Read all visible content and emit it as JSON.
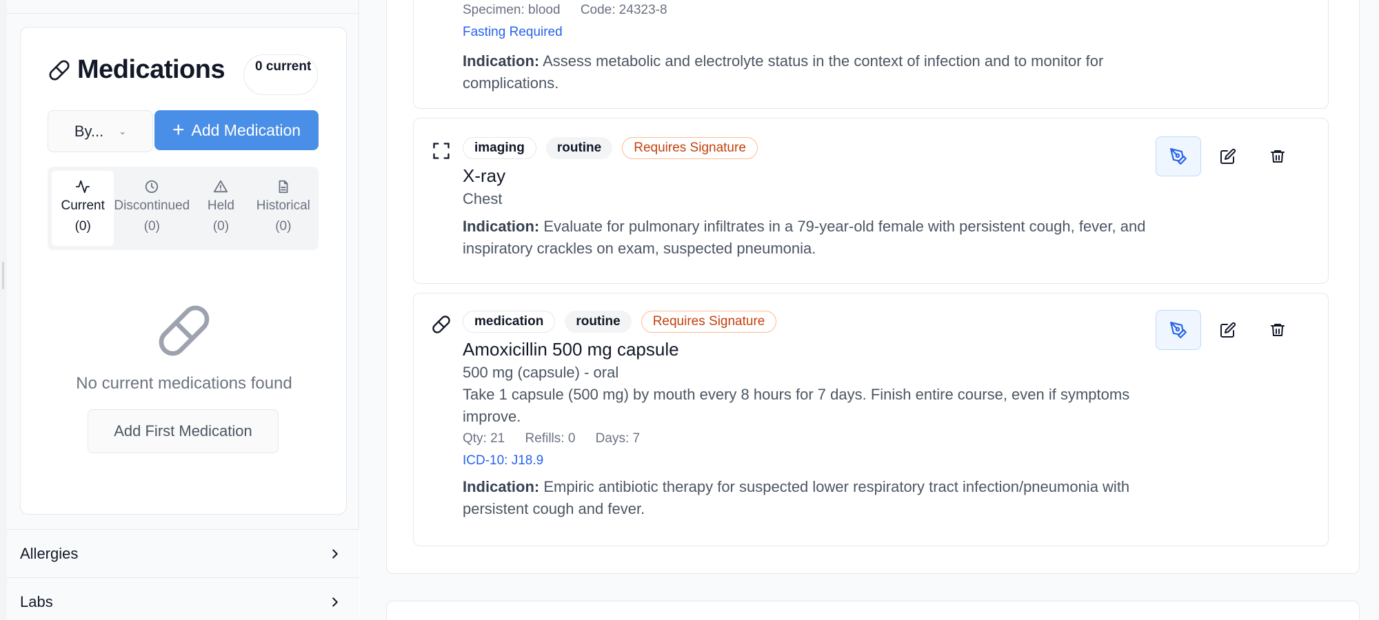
{
  "sidebar": {
    "medications": {
      "title": "Medications",
      "count_badge": "0 current",
      "sort_label": "By...",
      "add_button": "Add Medication",
      "tabs": [
        {
          "label": "Current",
          "count": "(0)",
          "icon": "activity-icon",
          "active": true
        },
        {
          "label": "Discontinued",
          "count": "(0)",
          "icon": "clock-icon",
          "active": false
        },
        {
          "label": "Held",
          "count": "(0)",
          "icon": "warning-icon",
          "active": false
        },
        {
          "label": "Historical",
          "count": "(0)",
          "icon": "document-icon",
          "active": false
        }
      ],
      "empty_text": "No current medications found",
      "empty_button": "Add First Medication"
    },
    "sections": [
      {
        "label": "Allergies"
      },
      {
        "label": "Labs"
      }
    ]
  },
  "orders": [
    {
      "specimen": "Specimen: blood",
      "code": "Code: 24323-8",
      "flag": "Fasting Required",
      "indication_label": "Indication:",
      "indication": " Assess metabolic and electrolyte status in the context of infection and to monitor for complications."
    },
    {
      "type": "imaging",
      "priority": "routine",
      "status": "Requires Signature",
      "title": "X-ray",
      "subtitle": "Chest",
      "indication_label": "Indication:",
      "indication": " Evaluate for pulmonary infiltrates in a 79-year-old female with persistent cough, fever, and inspiratory crackles on exam, suspected pneumonia."
    },
    {
      "type": "medication",
      "priority": "routine",
      "status": "Requires Signature",
      "title": "Amoxicillin 500 mg capsule",
      "dose": "500 mg (capsule) - oral",
      "sig": "Take 1 capsule (500 mg) by mouth every 8 hours for 7 days. Finish entire course, even if symptoms improve.",
      "qty": "Qty: 21",
      "refills": "Refills: 0",
      "days": "Days: 7",
      "icd": "ICD-10: J18.9",
      "indication_label": "Indication:",
      "indication": " Empiric antibiotic therapy for suspected lower respiratory tract infection/pneumonia with persistent cough and fever."
    }
  ],
  "colors": {
    "primary": "#4a8fe7",
    "signature": "#c2410c",
    "link": "#2563eb"
  }
}
